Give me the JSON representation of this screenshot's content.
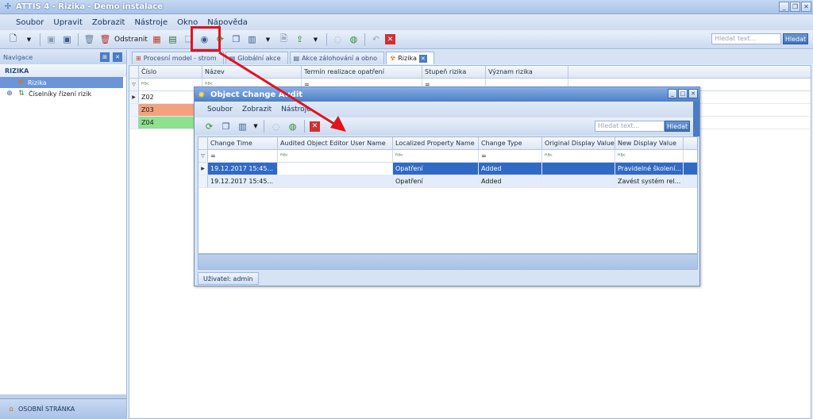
{
  "window": {
    "title": "ATTIS 4 - Rizika - Demo instalace"
  },
  "menu": [
    "Soubor",
    "Upravit",
    "Zobrazit",
    "Nástroje",
    "Okno",
    "Nápověda"
  ],
  "toolbar": {
    "remove_label": "Odstranit",
    "search_placeholder": "Hledat text...",
    "search_button": "Hledat"
  },
  "navigation": {
    "header": "Navigace",
    "section": "RIZIKA",
    "items": [
      {
        "label": "Rizika",
        "selected": true
      },
      {
        "label": "Číselníky řízení rizik",
        "selected": false
      }
    ],
    "footer": "OSOBNÍ STRÁNKA"
  },
  "tabs": [
    {
      "label": "Procesní model - strom"
    },
    {
      "label": "Globální akce"
    },
    {
      "label": "Akce zálohování a obno"
    },
    {
      "label": "Rizika",
      "active": true
    }
  ],
  "main_grid": {
    "columns": [
      "Číslo",
      "Název",
      "Termín realizace opatření",
      "Stupeň rizika",
      "Význam rizika"
    ],
    "filter_cells": [
      "",
      "",
      "=",
      "=",
      ""
    ],
    "rows": [
      {
        "id": "Z02",
        "color": "#ffffff"
      },
      {
        "id": "Z03",
        "color": "#f4a27e"
      },
      {
        "id": "Z04",
        "color": "#8fe08f"
      }
    ]
  },
  "dialog": {
    "title": "Object Change Audit",
    "menu": [
      "Soubor",
      "Zobrazit",
      "Nástroje"
    ],
    "search_placeholder": "Hledat text...",
    "search_button": "Hledat",
    "columns": [
      "Change Time",
      "Audited Object Editor User Name",
      "Localized Property Name",
      "Change Type",
      "Original Display Value",
      "New Display Value"
    ],
    "filter_cells": [
      "=",
      "",
      "",
      "=",
      "",
      ""
    ],
    "rows": [
      {
        "time": "19.12.2017 15:45...",
        "user": "",
        "property": "Opatření",
        "type": "Added",
        "original": "",
        "new": "Pravidelné školení..."
      },
      {
        "time": "19.12.2017 15:45...",
        "user": "",
        "property": "Opatření",
        "type": "Added",
        "original": "",
        "new": "Zavést systém rel..."
      }
    ],
    "status_user": "Uživatel: admin"
  },
  "colors": {
    "accent": "#316ac5",
    "annotation": "#e2131c"
  }
}
